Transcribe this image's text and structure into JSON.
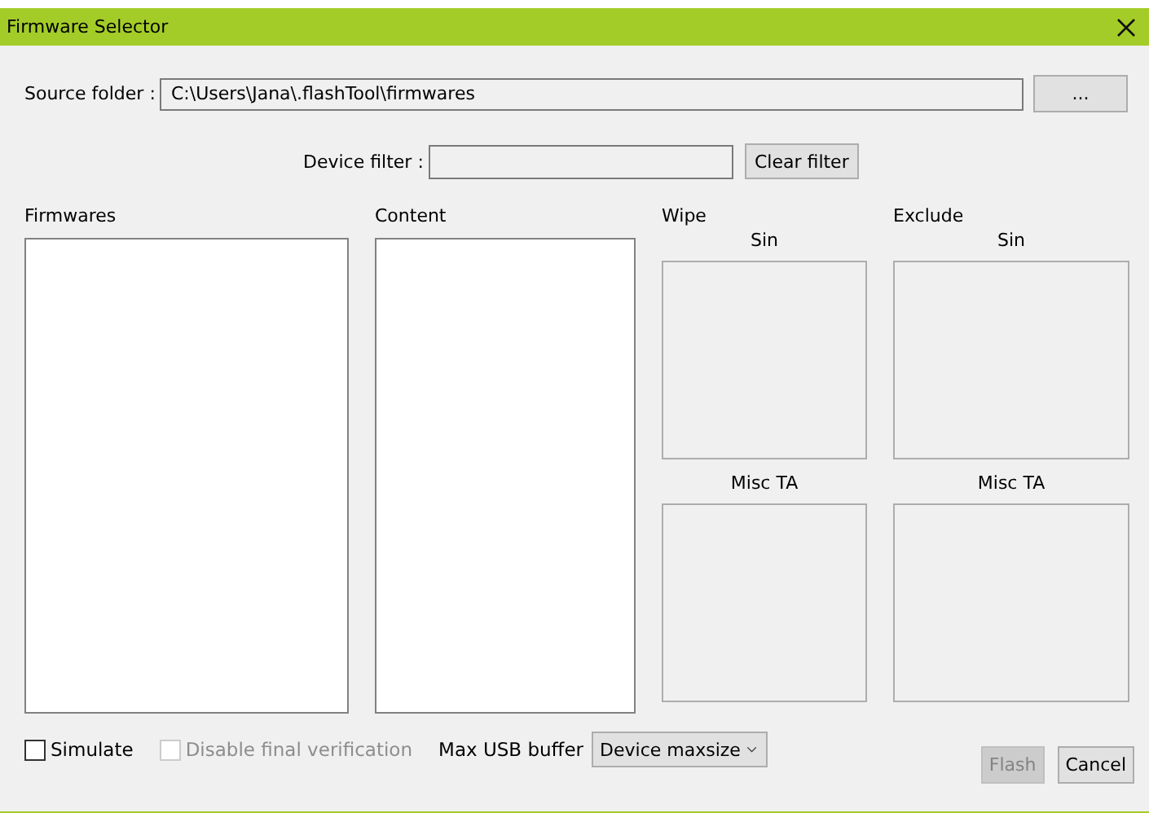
{
  "window": {
    "title": "Firmware Selector"
  },
  "source_folder": {
    "label": "Source folder :",
    "value": "C:\\Users\\Jana\\.flashTool\\firmwares",
    "browse": "..."
  },
  "device_filter": {
    "label": "Device filter :",
    "clear": "Clear filter"
  },
  "lists": [
    {
      "title": "Firmwares"
    },
    {
      "title": "Content"
    }
  ],
  "groups": [
    {
      "title": "Wipe",
      "boxes": [
        "Sin",
        "Misc TA"
      ]
    },
    {
      "title": "Exclude",
      "boxes": [
        "Sin",
        "Misc TA"
      ]
    }
  ],
  "options": [
    {
      "label": "Simulate",
      "checked": false,
      "disabled": false
    },
    {
      "label": "Disable final verification",
      "checked": false,
      "disabled": true
    }
  ],
  "max_usb_buffer": {
    "label": "Max USB buffer",
    "value": "Device maxsize"
  },
  "buttons": [
    {
      "label": "Flash",
      "disabled": true
    },
    {
      "label": "Cancel",
      "disabled": false
    }
  ]
}
